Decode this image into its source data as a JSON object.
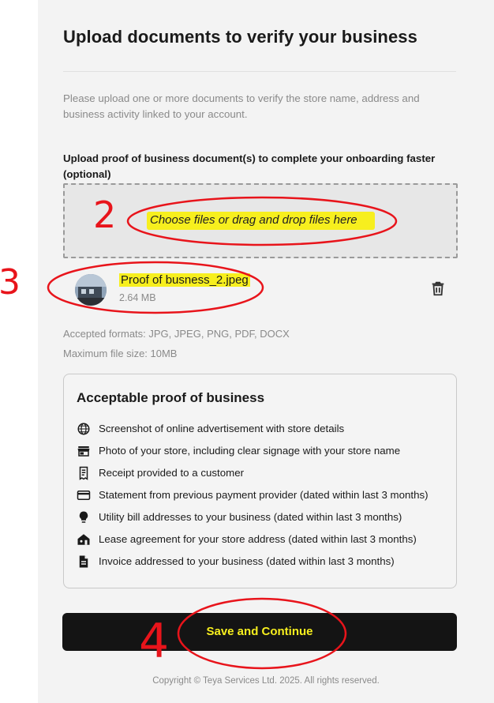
{
  "page": {
    "title": "Upload documents to verify your business",
    "intro": "Please upload one or more documents to verify the store name, address and business activity linked to your account."
  },
  "upload": {
    "label": "Upload proof of business document(s) to complete your onboarding faster (optional)",
    "dropzone_text": "Choose files or drag and drop files here",
    "file": {
      "name": "Proof of busness_2.jpeg",
      "size": "2.64 MB"
    },
    "accepted_formats": "Accepted formats: JPG, JPEG, PNG, PDF, DOCX",
    "max_size": "Maximum file size: 10MB"
  },
  "proof_card": {
    "title": "Acceptable proof of business",
    "items": [
      {
        "icon": "globe-icon",
        "text": "Screenshot of online advertisement with store details"
      },
      {
        "icon": "storefront-icon",
        "text": "Photo of your store, including clear signage with your store name"
      },
      {
        "icon": "receipt-icon",
        "text": "Receipt provided to a customer"
      },
      {
        "icon": "credit-card-icon",
        "text": "Statement from previous payment provider (dated within last 3 months)"
      },
      {
        "icon": "lightbulb-icon",
        "text": "Utility bill addresses to your business (dated within last 3 months)"
      },
      {
        "icon": "house-lease-icon",
        "text": "Lease agreement for your store address (dated within last 3 months)"
      },
      {
        "icon": "document-icon",
        "text": "Invoice addressed to your business (dated within last 3 months)"
      }
    ]
  },
  "actions": {
    "save_label": "Save and Continue"
  },
  "footer": {
    "copyright": "Copyright © Teya Services Ltd. 2025. All rights reserved."
  },
  "annotations": {
    "n2": "2",
    "n3": "3",
    "n4": "4",
    "color": "#e8141b"
  },
  "colors": {
    "highlight": "#f7ef1e",
    "button_bg": "#141414"
  }
}
